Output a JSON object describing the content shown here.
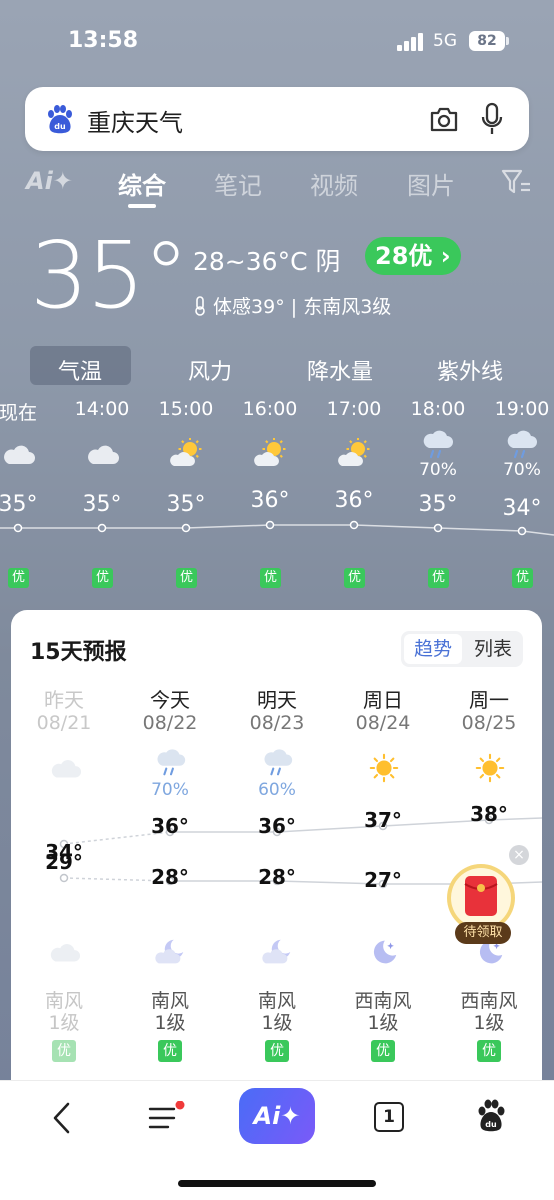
{
  "status": {
    "time": "13:58",
    "network": "5G",
    "battery": "82"
  },
  "search": {
    "query": "重庆天气"
  },
  "tabs": {
    "ai": "Ai✦",
    "items": [
      "综合",
      "笔记",
      "视频",
      "图片"
    ]
  },
  "current": {
    "temp": "35°",
    "range": "28~36°C  阴",
    "aqi": "28优 ›",
    "feels": "体感39°  |  东南风3级"
  },
  "metric_tabs": [
    "气温",
    "风力",
    "降水量",
    "紫外线"
  ],
  "hourly": [
    {
      "time": "现在",
      "icon": "cloudy-icon",
      "pop": "",
      "temp": "35°",
      "aqi": "优",
      "value": 35
    },
    {
      "time": "14:00",
      "icon": "cloudy-icon",
      "pop": "",
      "temp": "35°",
      "aqi": "优",
      "value": 35
    },
    {
      "time": "15:00",
      "icon": "partly-cloudy-icon",
      "pop": "",
      "temp": "35°",
      "aqi": "优",
      "value": 35
    },
    {
      "time": "16:00",
      "icon": "partly-cloudy-icon",
      "pop": "",
      "temp": "36°",
      "aqi": "优",
      "value": 36
    },
    {
      "time": "17:00",
      "icon": "partly-cloudy-icon",
      "pop": "",
      "temp": "36°",
      "aqi": "优",
      "value": 36
    },
    {
      "time": "18:00",
      "icon": "rain-icon",
      "pop": "70%",
      "temp": "35°",
      "aqi": "优",
      "value": 35
    },
    {
      "time": "19:00",
      "icon": "rain-icon",
      "pop": "70%",
      "temp": "34°",
      "aqi": "优",
      "value": 34
    }
  ],
  "forecast": {
    "title": "15天预报",
    "toggle": {
      "trend": "趋势",
      "list": "列表"
    },
    "days": [
      {
        "name": "昨天",
        "date": "08/21",
        "day_icon": "cloudy-icon",
        "pop": "",
        "hi": "34°",
        "lo": "29°",
        "night_icon": "cloudy-icon",
        "wind_dir": "南风",
        "wind_lvl": "1级",
        "aqi": "优",
        "hi_v": 34,
        "lo_v": 29
      },
      {
        "name": "今天",
        "date": "08/22",
        "day_icon": "rain-icon",
        "pop": "70%",
        "hi": "36°",
        "lo": "28°",
        "night_icon": "moon-cloud-icon",
        "wind_dir": "南风",
        "wind_lvl": "1级",
        "aqi": "优",
        "hi_v": 36,
        "lo_v": 28
      },
      {
        "name": "明天",
        "date": "08/23",
        "day_icon": "rain-icon",
        "pop": "60%",
        "hi": "36°",
        "lo": "28°",
        "night_icon": "moon-cloud-icon",
        "wind_dir": "南风",
        "wind_lvl": "1级",
        "aqi": "优",
        "hi_v": 36,
        "lo_v": 28
      },
      {
        "name": "周日",
        "date": "08/24",
        "day_icon": "sun-icon",
        "pop": "",
        "hi": "37°",
        "lo": "27°",
        "night_icon": "moon-star-icon",
        "wind_dir": "西南风",
        "wind_lvl": "1级",
        "aqi": "优",
        "hi_v": 37,
        "lo_v": 27
      },
      {
        "name": "周一",
        "date": "08/25",
        "day_icon": "sun-icon",
        "pop": "",
        "hi": "38°",
        "lo": "",
        "night_icon": "moon-star-icon",
        "wind_dir": "西南风",
        "wind_lvl": "1级",
        "aqi": "优",
        "hi_v": 38,
        "lo_v": 27
      }
    ]
  },
  "red_packet": {
    "label": "待领取",
    "close": "×"
  },
  "bottom_nav": {
    "ai": "Ai✦",
    "tabs_count": "1"
  },
  "colors": {
    "aqi_green": "#3ac85b",
    "accent_blue": "#4a72d6"
  }
}
